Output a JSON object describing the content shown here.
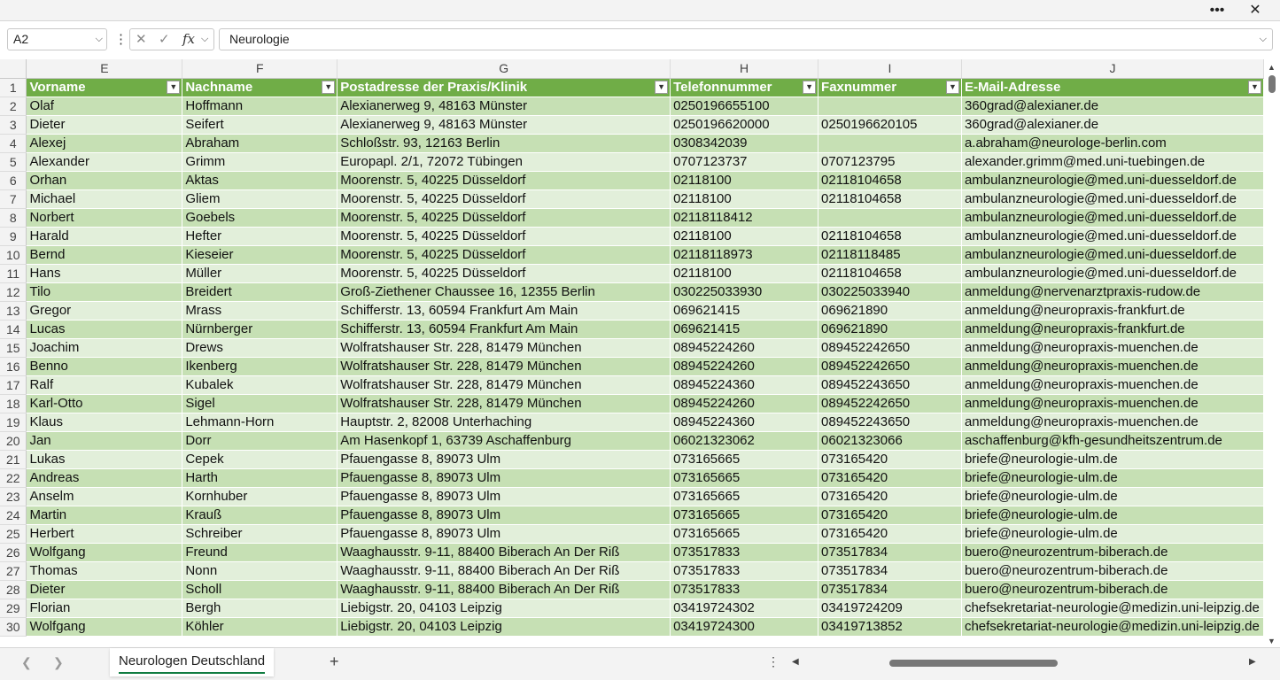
{
  "window": {
    "more_label": "•••",
    "close_label": "✕"
  },
  "formula_bar": {
    "name_box": "A2",
    "dots": "⋮",
    "cancel_icon": "✕",
    "enter_icon": "✓",
    "fx_label": "fx",
    "formula_value": "Neurologie"
  },
  "columns": [
    "E",
    "F",
    "G",
    "H",
    "I",
    "J"
  ],
  "header": [
    "Vorname",
    "Nachname",
    "Postadresse der Praxis/Klinik",
    "Telefonnummer",
    "Faxnummer",
    "E-Mail-Adresse"
  ],
  "rows": [
    {
      "n": "2",
      "c": [
        "Olaf",
        "Hoffmann",
        "Alexianerweg 9, 48163 Münster",
        "0250196655100",
        "",
        "360grad@alexianer.de"
      ]
    },
    {
      "n": "3",
      "c": [
        "Dieter",
        "Seifert",
        "Alexianerweg 9, 48163 Münster",
        "0250196620000",
        "0250196620105",
        "360grad@alexianer.de"
      ]
    },
    {
      "n": "4",
      "c": [
        "Alexej",
        "Abraham",
        "Schloßstr. 93, 12163 Berlin",
        "0308342039",
        "",
        "a.abraham@neurologe-berlin.com"
      ]
    },
    {
      "n": "5",
      "c": [
        "Alexander",
        "Grimm",
        "Europapl. 2/1, 72072 Tübingen",
        "0707123737",
        "0707123795",
        "alexander.grimm@med.uni-tuebingen.de"
      ]
    },
    {
      "n": "6",
      "c": [
        "Orhan",
        "Aktas",
        "Moorenstr. 5, 40225 Düsseldorf",
        "02118100",
        "02118104658",
        "ambulanzneurologie@med.uni-duesseldorf.de"
      ]
    },
    {
      "n": "7",
      "c": [
        "Michael",
        "Gliem",
        "Moorenstr. 5, 40225 Düsseldorf",
        "02118100",
        "02118104658",
        "ambulanzneurologie@med.uni-duesseldorf.de"
      ]
    },
    {
      "n": "8",
      "c": [
        "Norbert",
        "Goebels",
        "Moorenstr. 5, 40225 Düsseldorf",
        "02118118412",
        "",
        "ambulanzneurologie@med.uni-duesseldorf.de"
      ]
    },
    {
      "n": "9",
      "c": [
        "Harald",
        "Hefter",
        "Moorenstr. 5, 40225 Düsseldorf",
        "02118100",
        "02118104658",
        "ambulanzneurologie@med.uni-duesseldorf.de"
      ]
    },
    {
      "n": "10",
      "c": [
        "Bernd",
        "Kieseier",
        "Moorenstr. 5, 40225 Düsseldorf",
        "02118118973",
        "02118118485",
        "ambulanzneurologie@med.uni-duesseldorf.de"
      ]
    },
    {
      "n": "11",
      "c": [
        "Hans",
        "Müller",
        "Moorenstr. 5, 40225 Düsseldorf",
        "02118100",
        "02118104658",
        "ambulanzneurologie@med.uni-duesseldorf.de"
      ]
    },
    {
      "n": "12",
      "c": [
        "Tilo",
        "Breidert",
        "Groß-Ziethener Chaussee 16, 12355 Berlin",
        "030225033930",
        "030225033940",
        "anmeldung@nervenarztpraxis-rudow.de"
      ]
    },
    {
      "n": "13",
      "c": [
        "Gregor",
        "Mrass",
        "Schifferstr. 13, 60594 Frankfurt Am Main",
        "069621415",
        "069621890",
        "anmeldung@neuropraxis-frankfurt.de"
      ]
    },
    {
      "n": "14",
      "c": [
        "Lucas",
        "Nürnberger",
        "Schifferstr. 13, 60594 Frankfurt Am Main",
        "069621415",
        "069621890",
        "anmeldung@neuropraxis-frankfurt.de"
      ]
    },
    {
      "n": "15",
      "c": [
        "Joachim",
        "Drews",
        "Wolfratshauser Str. 228, 81479 München",
        "08945224260",
        "089452242650",
        "anmeldung@neuropraxis-muenchen.de"
      ]
    },
    {
      "n": "16",
      "c": [
        "Benno",
        "Ikenberg",
        "Wolfratshauser Str. 228, 81479 München",
        "08945224260",
        "089452242650",
        "anmeldung@neuropraxis-muenchen.de"
      ]
    },
    {
      "n": "17",
      "c": [
        "Ralf",
        "Kubalek",
        "Wolfratshauser Str. 228, 81479 München",
        "08945224360",
        "089452243650",
        "anmeldung@neuropraxis-muenchen.de"
      ]
    },
    {
      "n": "18",
      "c": [
        "Karl-Otto",
        "Sigel",
        "Wolfratshauser Str. 228, 81479 München",
        "08945224260",
        "089452242650",
        "anmeldung@neuropraxis-muenchen.de"
      ]
    },
    {
      "n": "19",
      "c": [
        "Klaus",
        "Lehmann-Horn",
        "Hauptstr. 2, 82008 Unterhaching",
        "08945224360",
        "089452243650",
        "anmeldung@neuropraxis-muenchen.de"
      ]
    },
    {
      "n": "20",
      "c": [
        "Jan",
        "Dorr",
        "Am Hasenkopf 1, 63739 Aschaffenburg",
        "06021323062",
        "06021323066",
        "aschaffenburg@kfh-gesundheitszentrum.de"
      ]
    },
    {
      "n": "21",
      "c": [
        "Lukas",
        "Cepek",
        "Pfauengasse 8, 89073 Ulm",
        "073165665",
        "073165420",
        "briefe@neurologie-ulm.de"
      ]
    },
    {
      "n": "22",
      "c": [
        "Andreas",
        "Harth",
        "Pfauengasse 8, 89073 Ulm",
        "073165665",
        "073165420",
        "briefe@neurologie-ulm.de"
      ]
    },
    {
      "n": "23",
      "c": [
        "Anselm",
        "Kornhuber",
        "Pfauengasse 8, 89073 Ulm",
        "073165665",
        "073165420",
        "briefe@neurologie-ulm.de"
      ]
    },
    {
      "n": "24",
      "c": [
        "Martin",
        "Krauß",
        "Pfauengasse 8, 89073 Ulm",
        "073165665",
        "073165420",
        "briefe@neurologie-ulm.de"
      ]
    },
    {
      "n": "25",
      "c": [
        "Herbert",
        "Schreiber",
        "Pfauengasse 8, 89073 Ulm",
        "073165665",
        "073165420",
        "briefe@neurologie-ulm.de"
      ]
    },
    {
      "n": "26",
      "c": [
        "Wolfgang",
        "Freund",
        "Waaghausstr. 9-11, 88400 Biberach An Der Riß",
        "073517833",
        "073517834",
        "buero@neurozentrum-biberach.de"
      ]
    },
    {
      "n": "27",
      "c": [
        "Thomas",
        "Nonn",
        "Waaghausstr. 9-11, 88400 Biberach An Der Riß",
        "073517833",
        "073517834",
        "buero@neurozentrum-biberach.de"
      ]
    },
    {
      "n": "28",
      "c": [
        "Dieter",
        "Scholl",
        "Waaghausstr. 9-11, 88400 Biberach An Der Riß",
        "073517833",
        "073517834",
        "buero@neurozentrum-biberach.de"
      ]
    },
    {
      "n": "29",
      "c": [
        "Florian",
        "Bergh",
        "Liebigstr. 20, 04103 Leipzig",
        "03419724302",
        "03419724209",
        "chefsekretariat-neurologie@medizin.uni-leipzig.de"
      ]
    },
    {
      "n": "30",
      "c": [
        "Wolfgang",
        "Köhler",
        "Liebigstr. 20, 04103 Leipzig",
        "03419724300",
        "03419713852",
        "chefsekretariat-neurologie@medizin.uni-leipzig.de"
      ]
    }
  ],
  "sheet_tabs": {
    "active": "Neurologen Deutschland",
    "add_label": "+"
  },
  "scroll": {
    "more_label": "⋮"
  }
}
